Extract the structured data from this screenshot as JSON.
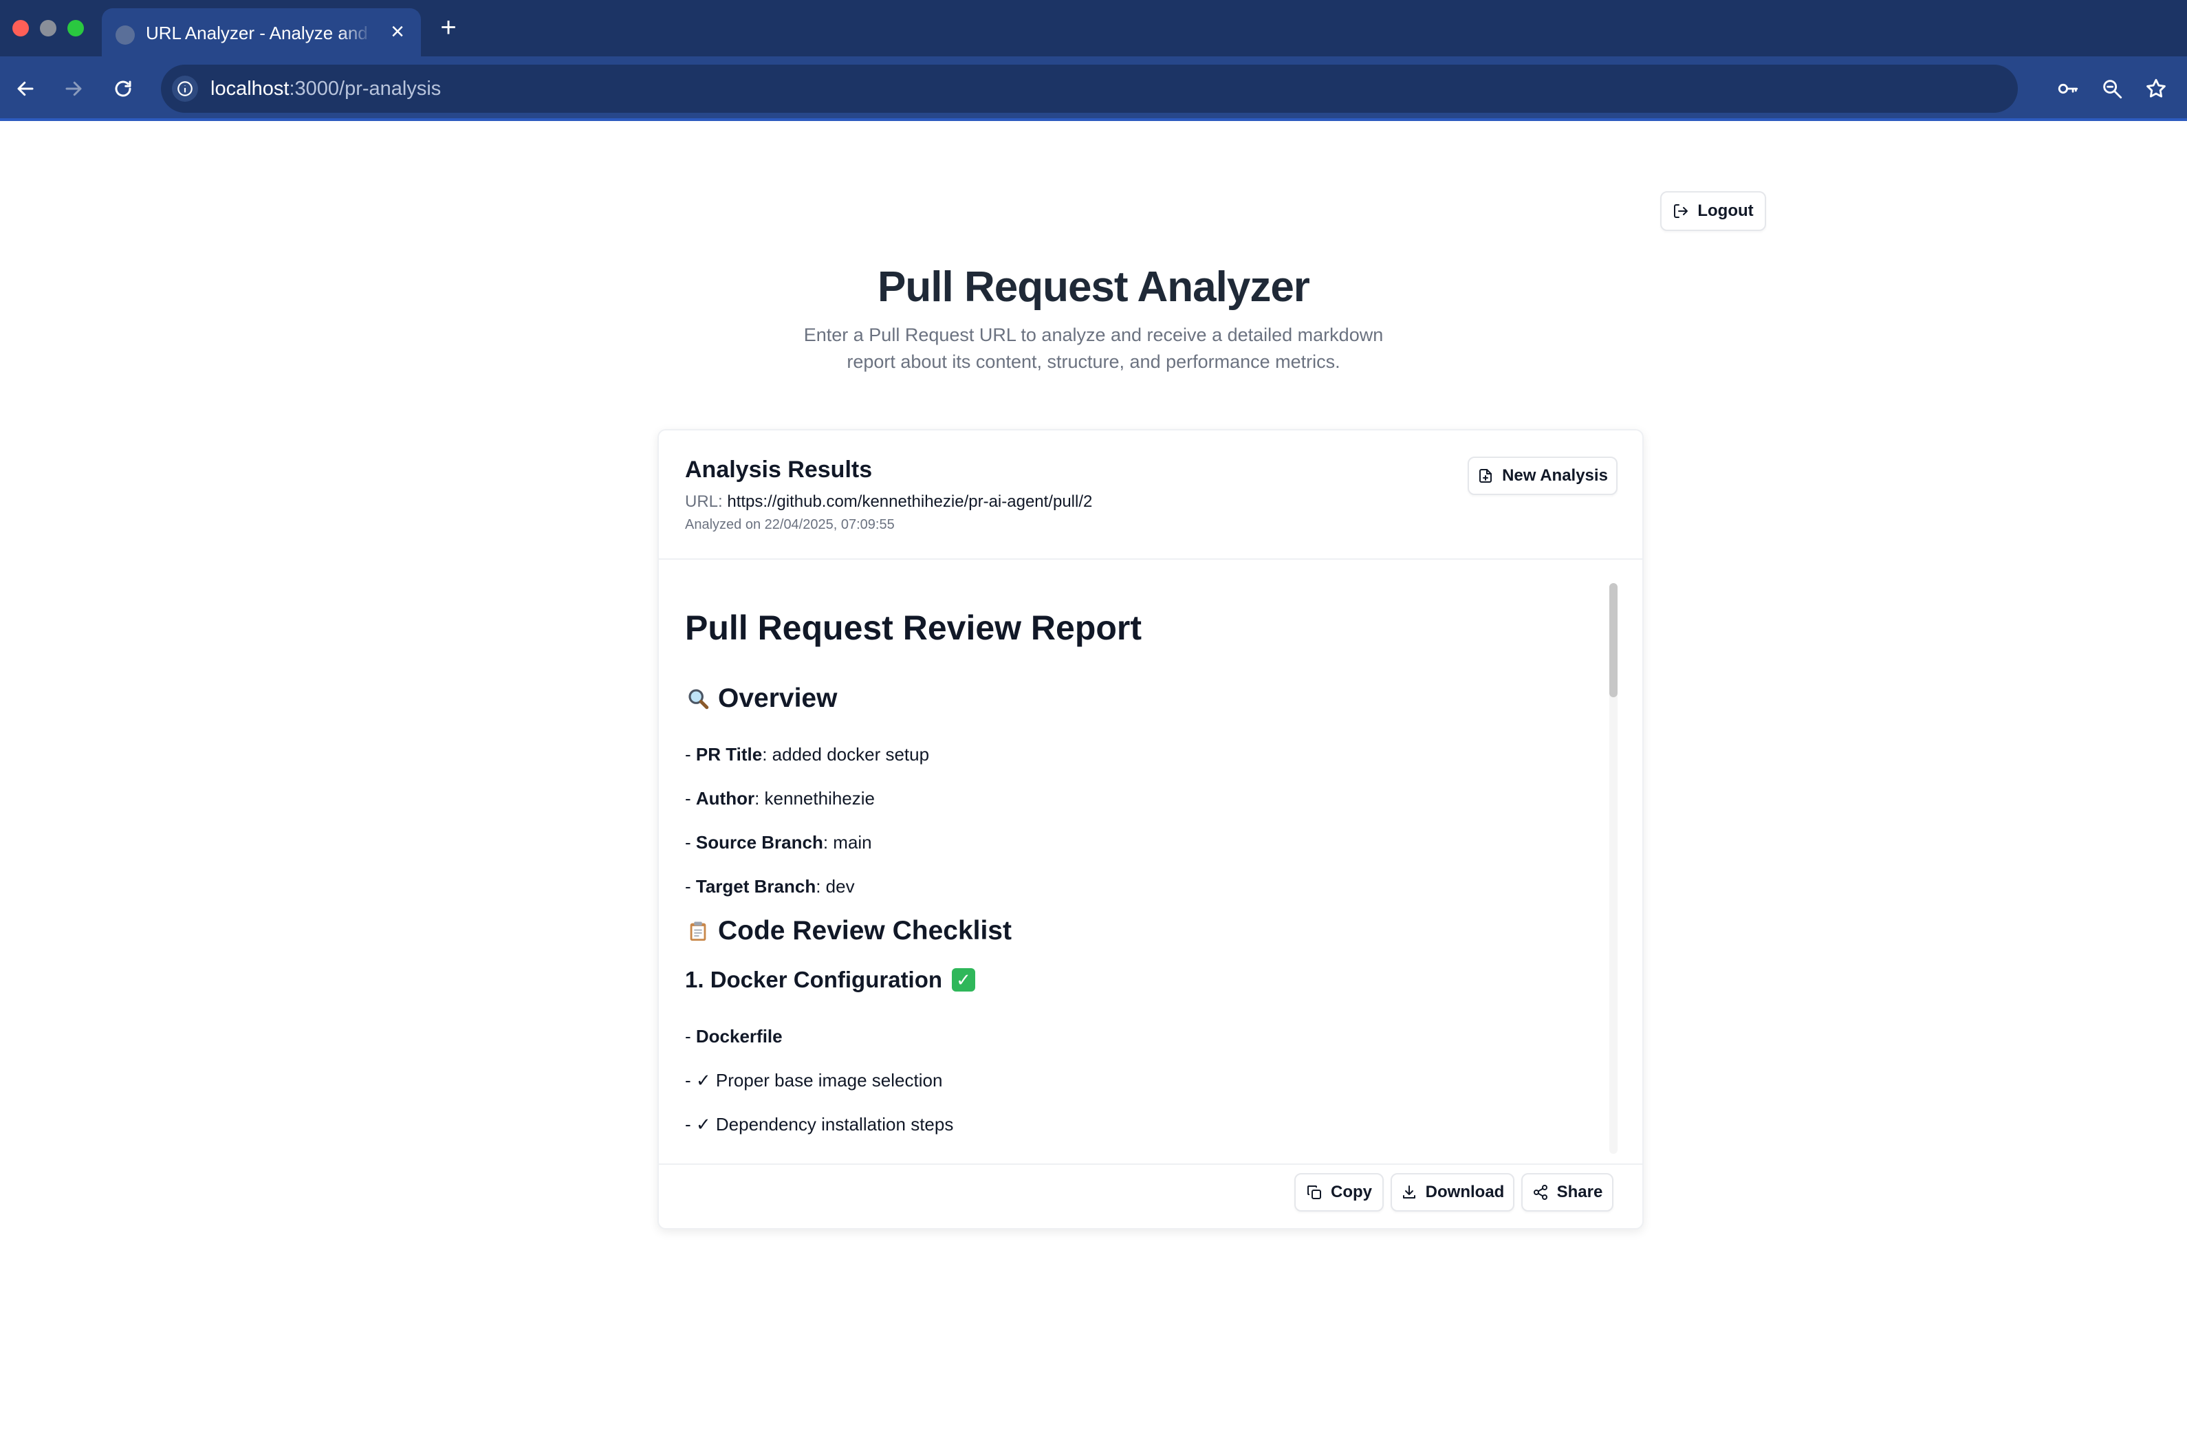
{
  "browser": {
    "tab_title": "URL Analyzer - Analyze and Visualize",
    "tab_close": "×",
    "new_tab": "+",
    "url_host": "localhost",
    "url_path": ":3000/pr-analysis"
  },
  "colors": {
    "tabstrip": "#1c3465",
    "toolbar": "#27478a",
    "heading": "#1f2937",
    "muted": "#6b7280",
    "success": "#2fb75a"
  },
  "header": {
    "logout_label": "Logout",
    "title": "Pull Request Analyzer",
    "subtitle": "Enter a Pull Request URL to analyze and receive a detailed markdown report about its content, structure, and performance metrics."
  },
  "results": {
    "title": "Analysis Results",
    "url_label": "URL:",
    "url_value": "https://github.com/kennethihezie/pr-ai-agent/pull/2",
    "analyzed_on": "Analyzed on 22/04/2025, 07:09:55",
    "new_analysis_label": "New Analysis"
  },
  "report": {
    "title": "Pull Request Review Report",
    "overview_heading": "Overview",
    "overview_icon": "magnifier-icon",
    "overview_items": [
      {
        "key": "PR Title",
        "value": ": added docker setup"
      },
      {
        "key": "Author",
        "value": ": kennethihezie"
      },
      {
        "key": "Source Branch",
        "value": ": main"
      },
      {
        "key": "Target Branch",
        "value": ": dev"
      }
    ],
    "checklist_heading": "Code Review Checklist",
    "checklist_icon": "clipboard-icon",
    "section1_heading": "1. Docker Configuration",
    "section1_icon": "check-mark-button-icon",
    "section1_sub": "Dockerfile",
    "section1_items": [
      "✓ Proper base image selection",
      "✓ Dependency installation steps"
    ]
  },
  "footer": {
    "copy_label": "Copy",
    "download_label": "Download",
    "share_label": "Share"
  }
}
